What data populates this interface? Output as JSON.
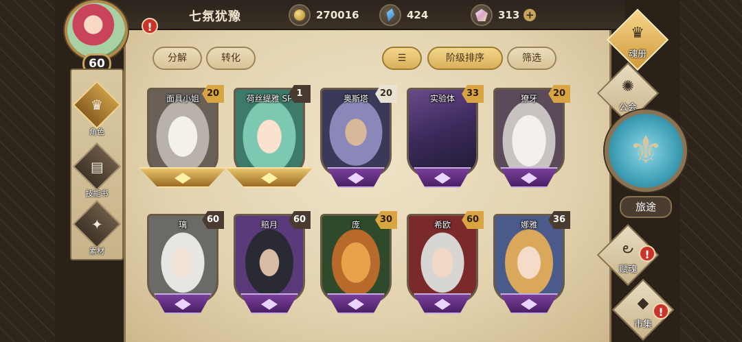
{
  "player": {
    "name": "七氛犹豫",
    "level": "60"
  },
  "currencies": {
    "gold": "270016",
    "gems": "424",
    "crystals": "313",
    "plus": "+"
  },
  "tabs": {
    "decompose": "分解",
    "convert": "转化",
    "sort_rank": "阶级排序",
    "filter": "筛选"
  },
  "left_nav": [
    {
      "label": "角色",
      "icon": "character-icon"
    },
    {
      "label": "技能书",
      "icon": "skillbook-icon"
    },
    {
      "label": "素材",
      "icon": "material-icon"
    }
  ],
  "right_nav": {
    "soul_book": "魂册",
    "guild": "公会",
    "journey": "旅途",
    "fu_soul": "赋魂",
    "market": "市集"
  },
  "cards": [
    {
      "name": "面具小姐",
      "level": "20",
      "rarity": "gold"
    },
    {
      "name": "荷丝缇雅 SP",
      "level": "1",
      "rarity": "gold"
    },
    {
      "name": "奥斯塔",
      "level": "20",
      "rarity": "purple"
    },
    {
      "name": "实验体",
      "level": "33",
      "rarity": "purple"
    },
    {
      "name": "獠牙",
      "level": "20",
      "rarity": "purple"
    },
    {
      "name": "璃",
      "level": "60",
      "rarity": "purple"
    },
    {
      "name": "賠月",
      "level": "60",
      "rarity": "purple"
    },
    {
      "name": "庞",
      "level": "30",
      "rarity": "purple"
    },
    {
      "name": "希欧",
      "level": "60",
      "rarity": "purple"
    },
    {
      "name": "娜雅",
      "level": "36",
      "rarity": "purple"
    }
  ],
  "alert_mark": "!"
}
